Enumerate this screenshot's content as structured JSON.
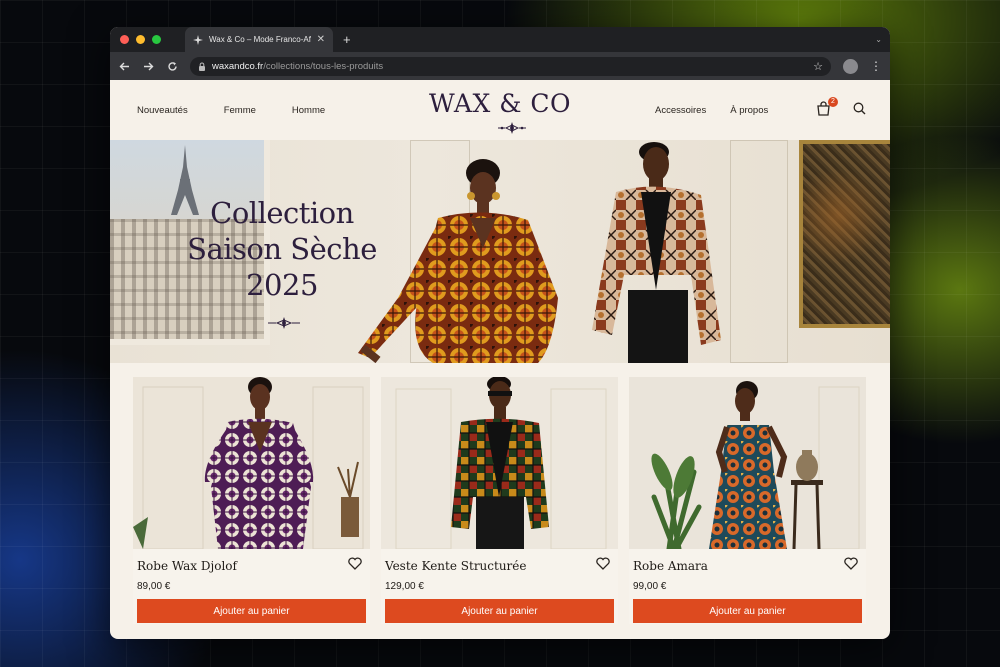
{
  "browser": {
    "tab_title": "Wax & Co – Mode Franco-Africaine",
    "url_host": "waxandco.fr",
    "url_path": "/collections/tous-les-produits"
  },
  "site": {
    "logo": "WAX & CO",
    "nav_left": [
      "Nouveautés",
      "Femme",
      "Homme"
    ],
    "nav_right": [
      "Accessoires",
      "À propos"
    ],
    "cart_count": "2"
  },
  "hero": {
    "title_lines": [
      "Collection",
      "Saison Sèche",
      "2025"
    ]
  },
  "products": [
    {
      "name": "Robe Wax Djolof",
      "price": "89,00 €",
      "button": "Ajouter au panier"
    },
    {
      "name": "Veste Kente Structurée",
      "price": "129,00 €",
      "button": "Ajouter au panier"
    },
    {
      "name": "Robe Amara",
      "price": "99,00 €",
      "button": "Ajouter au panier"
    }
  ],
  "colors": {
    "accent": "#dd4a1f",
    "brand": "#2d1f3d",
    "page_bg": "#f6f1e9"
  },
  "icons": [
    "back-arrow-icon",
    "forward-arrow-icon",
    "reload-icon",
    "lock-icon",
    "star-icon",
    "profile-icon",
    "cart-icon",
    "search-icon",
    "heart-icon"
  ]
}
